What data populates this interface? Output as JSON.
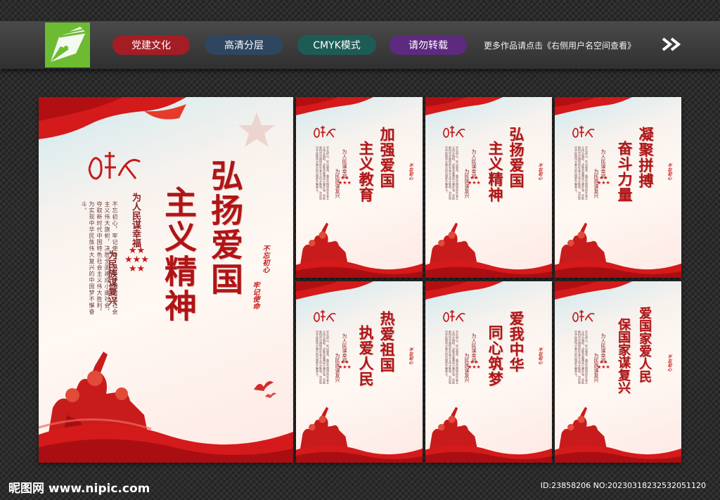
{
  "header": {
    "tags": [
      {
        "label": "党建文化",
        "color": "#a51d24"
      },
      {
        "label": "高清分层",
        "color": "#2e4660"
      },
      {
        "label": "CMYK模式",
        "color": "#1d5c55"
      },
      {
        "label": "请勿转载",
        "color": "#5d2a80"
      }
    ],
    "note": "更多作品请点击《右侧用户名空间查看》"
  },
  "main_poster": {
    "title_lines": [
      "弘扬爱国",
      "主义精神"
    ],
    "slogans": [
      "为人民谋幸福",
      "为民族谋复兴"
    ],
    "seal": [
      "不忘初心",
      "牢记使命"
    ],
    "body": "不忘初心，牢记使命，高举中国特色社会主义伟大旗帜，决胜全面建成小康社会，夺取新时代中国特色社会主义伟大胜利，为实现中华民族伟大复兴的中国梦不懈奋斗。"
  },
  "small_posters": [
    {
      "title_lines": [
        "加强爱国",
        "主义教育"
      ]
    },
    {
      "title_lines": [
        "弘扬爱国",
        "主义精神"
      ]
    },
    {
      "title_lines": [
        "凝聚拼搏",
        "奋斗力量"
      ]
    },
    {
      "title_lines": [
        "热爱祖国",
        "执爱人民"
      ]
    },
    {
      "title_lines": [
        "爱我中华",
        "同心筑梦"
      ]
    },
    {
      "title_lines": [
        "爱国家爱人民",
        "保国家谋复兴"
      ]
    }
  ],
  "footer": {
    "site": "昵图网 www.nipic.com",
    "id_text": "ID:23858206 NO:20230318232532051120"
  },
  "colors": {
    "accent_red": "#c41a1a",
    "title_red": "#b01516",
    "logo_green": "#6dbb32"
  }
}
